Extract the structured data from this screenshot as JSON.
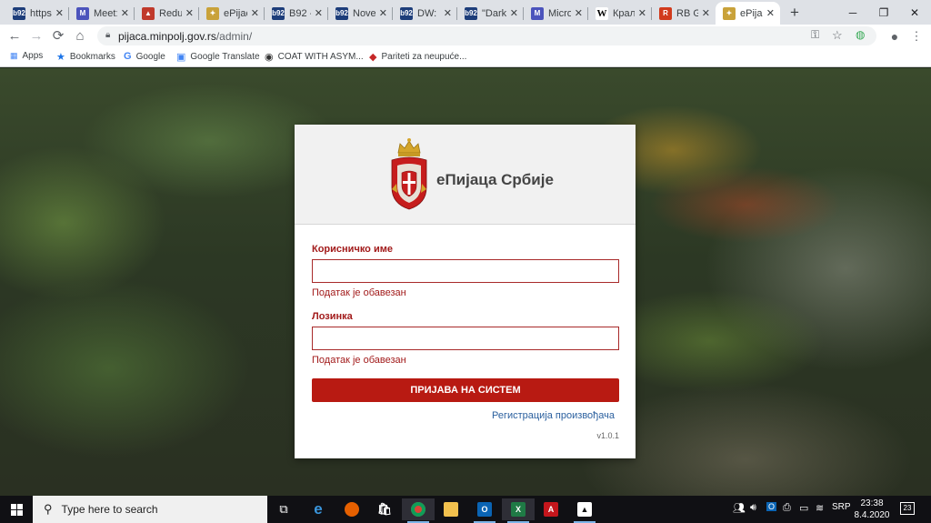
{
  "tabs": [
    {
      "title": "https:",
      "fav_text": "b92",
      "fav_color": "#1d3d7a"
    },
    {
      "title": "Meet:",
      "fav_text": "M",
      "fav_color": "#4b53bc"
    },
    {
      "title": "Redu",
      "fav_text": "▲",
      "fav_color": "#c0392b"
    },
    {
      "title": "ePijac",
      "fav_text": "✦",
      "fav_color": "#c9a23a"
    },
    {
      "title": "B92 -",
      "fav_text": "b92",
      "fav_color": "#1d3d7a"
    },
    {
      "title": "Nove",
      "fav_text": "b92",
      "fav_color": "#1d3d7a"
    },
    {
      "title": "DW: I",
      "fav_text": "b92",
      "fav_color": "#1d3d7a"
    },
    {
      "title": "\"Dark",
      "fav_text": "b92",
      "fav_color": "#1d3d7a"
    },
    {
      "title": "Micro",
      "fav_text": "M",
      "fav_color": "#4b53bc"
    },
    {
      "title": "Краљ",
      "fav_text": "W",
      "fav_color": "#ffffff"
    },
    {
      "title": "RB Gl",
      "fav_text": "R",
      "fav_color": "#d13a1c"
    },
    {
      "title": "ePijac",
      "fav_text": "✦",
      "fav_color": "#c9a23a"
    }
  ],
  "browser": {
    "url_host": "pijaca.minpolj.gov.rs",
    "url_path": "/admin/"
  },
  "bookmarks": {
    "apps": "Apps",
    "bookmarks": "Bookmarks",
    "google": "Google",
    "translate": "Google Translate",
    "coat": "COAT WITH ASYM...",
    "pariteti": "Pariteti za neupuće..."
  },
  "login": {
    "brand": "еПијаца Србије",
    "username_label": "Корисничко име",
    "username_value": "",
    "username_error": "Податак је обавезан",
    "password_label": "Лозинка",
    "password_value": "",
    "password_error": "Податак је обавезан",
    "submit": "ПРИЈАВА НА СИСТЕМ",
    "register": "Регистрација произвођача",
    "version": "v1.0.1"
  },
  "taskbar": {
    "search_placeholder": "Type here to search",
    "lang": "SRP",
    "time": "23:38",
    "date": "8.4.2020",
    "notifications": "23"
  },
  "colors": {
    "accent_red": "#b81a12",
    "link_blue": "#2a5f9e"
  }
}
